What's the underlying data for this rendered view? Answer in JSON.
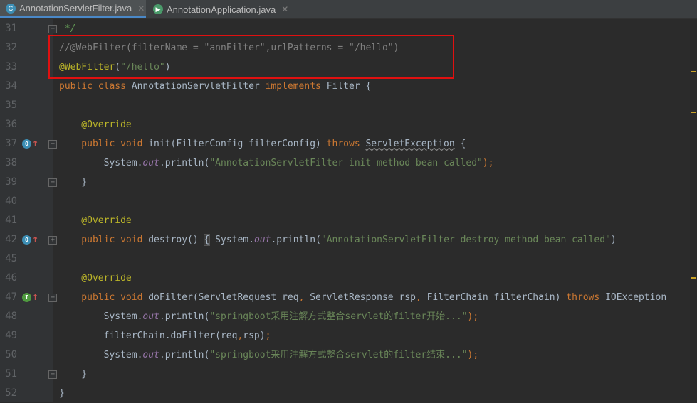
{
  "tabs": [
    {
      "label": "AnnotationServletFilter.java",
      "icon": "class-icon",
      "active": true
    },
    {
      "label": "AnnotationApplication.java",
      "icon": "spring-boot-app-icon",
      "active": false
    }
  ],
  "colors": {
    "keyword": "#cc7832",
    "string": "#6a8759",
    "annotation": "#bbb529",
    "comment": "#808080",
    "text": "#a9b7c6",
    "highlight": "#e01010"
  },
  "lines": [
    {
      "n": "31",
      "fold": "-",
      "tokens": [
        [
          " */",
          "doc"
        ]
      ]
    },
    {
      "n": "32",
      "tokens": [
        [
          "//@WebFilter(filterName = \"annFilter\",urlPatterns = \"/hello\")",
          "cmt"
        ]
      ]
    },
    {
      "n": "33",
      "tokens": [
        [
          "@WebFilter",
          "ann"
        ],
        [
          "(",
          ""
        ],
        [
          "\"/hello\"",
          "str"
        ],
        [
          ")",
          ""
        ]
      ]
    },
    {
      "n": "34",
      "tokens": [
        [
          "public class ",
          "kw"
        ],
        [
          "AnnotationServletFilter ",
          ""
        ],
        [
          "implements ",
          "kw"
        ],
        [
          "Filter {",
          ""
        ]
      ]
    },
    {
      "n": "35",
      "tokens": []
    },
    {
      "n": "36",
      "tokens": [
        [
          "    @Override",
          "ann"
        ]
      ]
    },
    {
      "n": "37",
      "icon": "O",
      "fold": "-",
      "tokens": [
        [
          "    public void ",
          "kw"
        ],
        [
          "init(FilterConfig filterConfig) ",
          ""
        ],
        [
          "throws ",
          "kw"
        ],
        [
          "ServletException",
          "wavy"
        ],
        [
          " {",
          ""
        ]
      ]
    },
    {
      "n": "38",
      "tokens": [
        [
          "        System.",
          ""
        ],
        [
          "out",
          "fld"
        ],
        [
          ".println(",
          ""
        ],
        [
          "\"AnnotationServletFilter init method bean called\"",
          "str"
        ],
        [
          ");",
          "kw"
        ]
      ]
    },
    {
      "n": "39",
      "fold": "-",
      "tokens": [
        [
          "    }",
          ""
        ]
      ]
    },
    {
      "n": "40",
      "tokens": []
    },
    {
      "n": "41",
      "tokens": [
        [
          "    @Override",
          "ann"
        ]
      ]
    },
    {
      "n": "42",
      "icon": "O",
      "fold": "+",
      "tokens": [
        [
          "    public void ",
          "kw"
        ],
        [
          "destroy() ",
          ""
        ],
        [
          "{",
          "brace"
        ],
        [
          " System.",
          ""
        ],
        [
          "out",
          "fld"
        ],
        [
          ".println(",
          ""
        ],
        [
          "\"AnnotationServletFilter destroy method bean called\"",
          "str"
        ],
        [
          ")",
          ""
        ]
      ]
    },
    {
      "n": "45",
      "tokens": []
    },
    {
      "n": "46",
      "tokens": [
        [
          "    @Override",
          "ann"
        ]
      ]
    },
    {
      "n": "47",
      "icon": "I",
      "fold": "-",
      "tokens": [
        [
          "    public void ",
          "kw"
        ],
        [
          "doFilter(ServletRequest req",
          ""
        ],
        [
          ", ",
          "kw"
        ],
        [
          "ServletResponse rsp",
          ""
        ],
        [
          ", ",
          "kw"
        ],
        [
          "FilterChain filterChain) ",
          ""
        ],
        [
          "throws ",
          "kw"
        ],
        [
          "IOException",
          ""
        ]
      ]
    },
    {
      "n": "48",
      "tokens": [
        [
          "        System.",
          ""
        ],
        [
          "out",
          "fld"
        ],
        [
          ".println(",
          ""
        ],
        [
          "\"springboot采用注解方式整合servlet的filter开始...\"",
          "str"
        ],
        [
          ");",
          "kw"
        ]
      ]
    },
    {
      "n": "49",
      "tokens": [
        [
          "        filterChain.doFilter(req",
          ""
        ],
        [
          ",",
          "kw"
        ],
        [
          "rsp)",
          ""
        ],
        [
          ";",
          "kw"
        ]
      ]
    },
    {
      "n": "50",
      "tokens": [
        [
          "        System.",
          ""
        ],
        [
          "out",
          "fld"
        ],
        [
          ".println(",
          ""
        ],
        [
          "\"springboot采用注解方式整合servlet的filter结束...\"",
          "str"
        ],
        [
          ");",
          "kw"
        ]
      ]
    },
    {
      "n": "51",
      "fold": "-",
      "tokens": [
        [
          "    }",
          ""
        ]
      ]
    },
    {
      "n": "52",
      "tokens": [
        [
          "}",
          ""
        ]
      ]
    }
  ]
}
